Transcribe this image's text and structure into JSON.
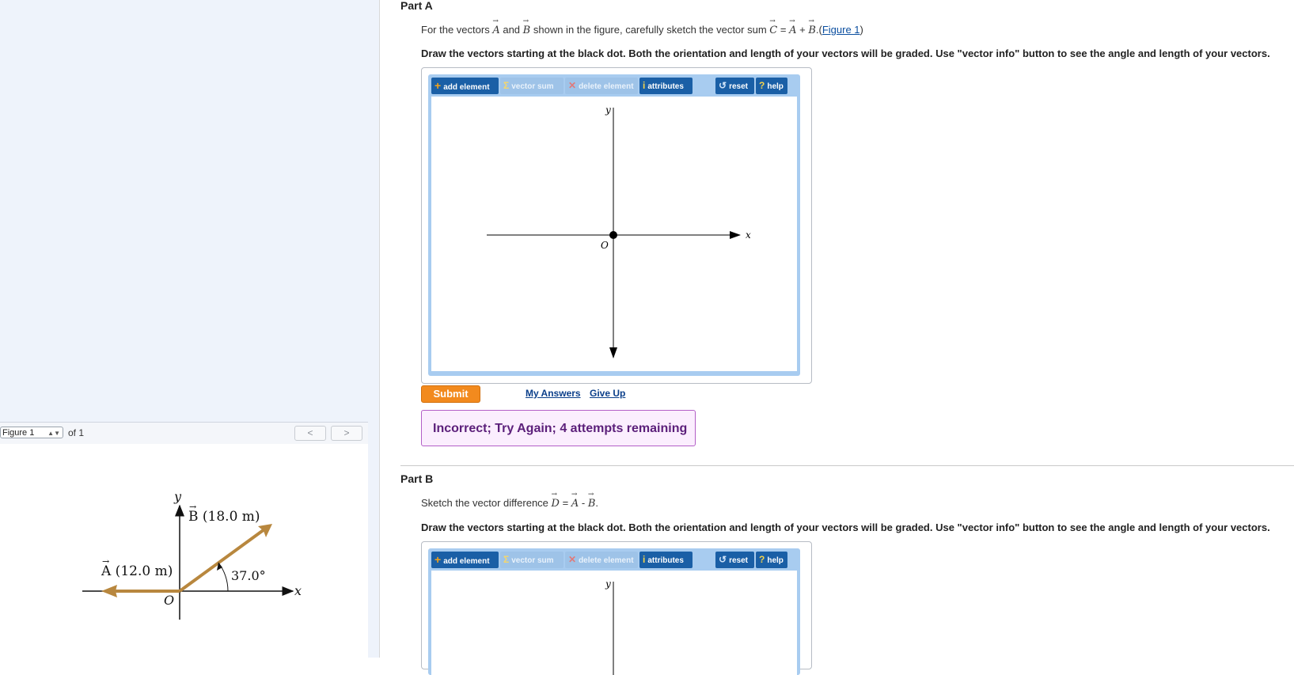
{
  "figure_panel": {
    "selected_figure": "Figure 1",
    "of_label": "of 1",
    "prev_icon": "chevron-left-icon",
    "next_icon": "chevron-right-icon",
    "diagram": {
      "y_label": "y",
      "x_label": "x",
      "origin_label": "O",
      "vector_a_label": "A (12.0 m)",
      "vector_b_label": "B (18.0 m)",
      "angle_label": "37.0°",
      "vector_color": "#b8873e"
    }
  },
  "part_a": {
    "title": "Part A",
    "prompt_pre": "For the vectors",
    "vec_a": "A",
    "and_word": "and",
    "vec_b": "B",
    "prompt_mid": "shown in the figure, carefully sketch the vector sum",
    "vec_c": "C",
    "eq": "=",
    "plus": "+",
    "period": ".(",
    "figure_link": "Figure 1",
    "close_paren": ")",
    "instruction": "Draw the vectors starting at the black dot. Both the orientation and length of your vectors will be graded. Use \"vector info\" button to see the angle and length of your vectors.",
    "toolbar": {
      "add": "add element",
      "sum": "vector sum",
      "delete": "delete element",
      "attributes": "attributes",
      "reset": "reset",
      "help": "help"
    },
    "axes": {
      "y": "y",
      "x": "x",
      "origin": "O"
    },
    "submit": "Submit",
    "my_answers": "My Answers",
    "give_up": "Give Up",
    "feedback": "Incorrect; Try Again; 4 attempts remaining"
  },
  "part_b": {
    "title": "Part B",
    "prompt_pre": "Sketch the vector difference",
    "vec_d": "D",
    "eq": "=",
    "vec_a": "A",
    "minus": "-",
    "vec_b": "B",
    "period": ".",
    "instruction": "Draw the vectors starting at the black dot. Both the orientation and length of your vectors will be graded. Use \"vector info\" button to see the angle and length of your vectors.",
    "toolbar": {
      "add": "add element",
      "sum": "vector sum",
      "delete": "delete element",
      "attributes": "attributes",
      "reset": "reset",
      "help": "help"
    },
    "axes": {
      "y": "y"
    }
  },
  "colors": {
    "accent": "#1a5fa6",
    "submit": "#f28a1e",
    "feedback_border": "#b35fc7",
    "feedback_text": "#5b1f7a"
  }
}
